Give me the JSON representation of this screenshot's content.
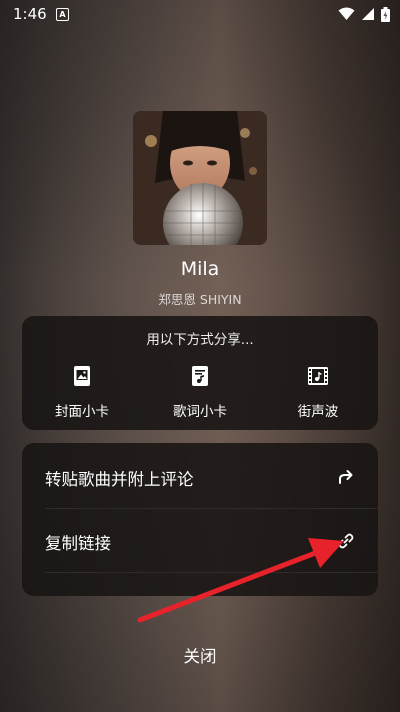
{
  "status_bar": {
    "time": "1:46",
    "notification_icon": "A"
  },
  "song": {
    "title": "Mila",
    "artist": "郑思恩 SHIYIN"
  },
  "share_panel": {
    "heading": "用以下方式分享...",
    "options": [
      {
        "label": "封面小卡",
        "icon": "image-card-icon"
      },
      {
        "label": "歌词小卡",
        "icon": "lyrics-card-icon"
      },
      {
        "label": "街声波",
        "icon": "film-music-icon"
      }
    ]
  },
  "actions": [
    {
      "label": "转贴歌曲并附上评论",
      "icon": "share-arrow-icon"
    },
    {
      "label": "复制链接",
      "icon": "link-icon"
    }
  ],
  "close_label": "关闭",
  "colors": {
    "annotation_arrow": "#e8222a",
    "card_bg": "#181413"
  }
}
